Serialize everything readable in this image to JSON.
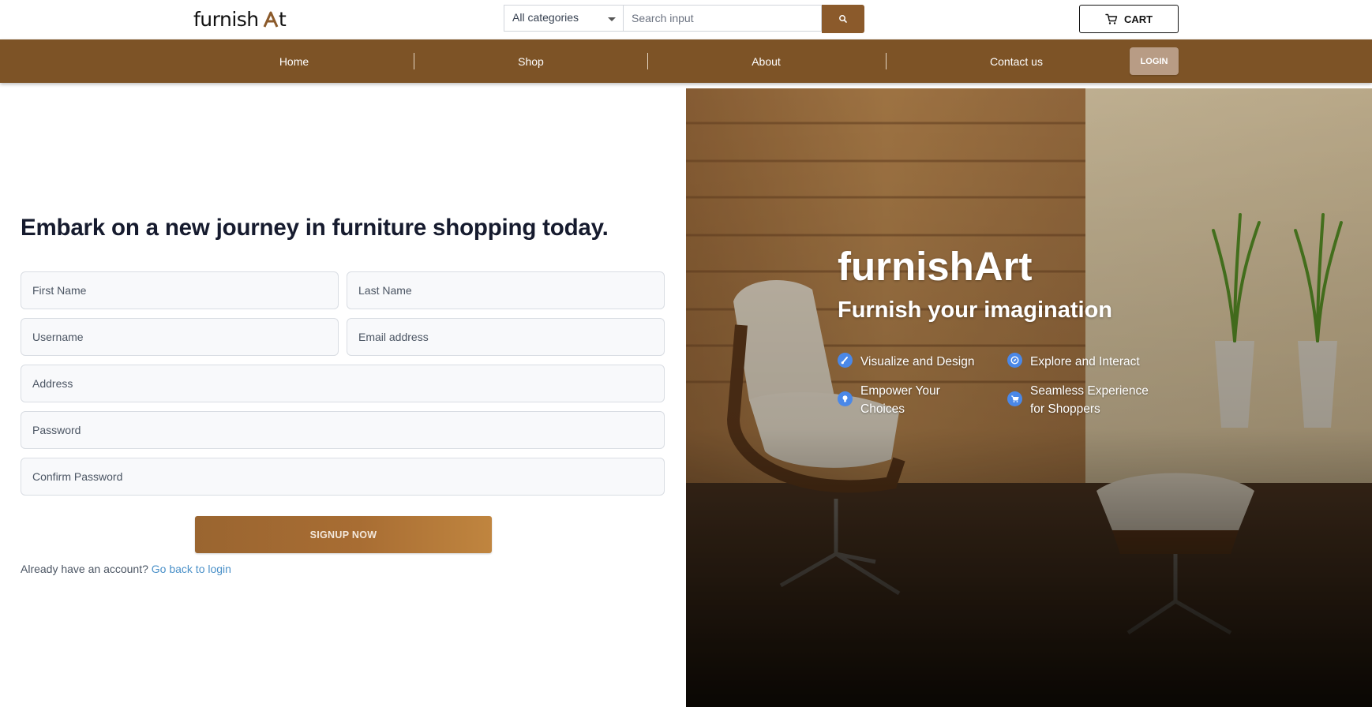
{
  "header": {
    "logo_text": "furnishArt",
    "category_select": "All categories",
    "search_placeholder": "Search input",
    "cart_label": "CART"
  },
  "nav": {
    "items": [
      {
        "label": "Home"
      },
      {
        "label": "Shop"
      },
      {
        "label": "About"
      },
      {
        "label": "Contact us"
      }
    ],
    "login_label": "LOGIN"
  },
  "form": {
    "heading": "Embark on a new journey in furniture shopping today.",
    "first_name_placeholder": "First Name",
    "last_name_placeholder": "Last Name",
    "username_placeholder": "Username",
    "email_placeholder": "Email address",
    "address_placeholder": "Address",
    "password_placeholder": "Password",
    "confirm_password_placeholder": "Confirm Password",
    "signup_label": "SIGNUP NOW",
    "already_text": "Already have an account?",
    "login_link": "Go back to login"
  },
  "hero": {
    "title": "furnishArt",
    "subtitle": "Furnish your imagination",
    "features": [
      {
        "icon": "brush-icon",
        "line1": "Visualize and Design",
        "line2": ""
      },
      {
        "icon": "compass-icon",
        "line1": "Explore and Interact",
        "line2": ""
      },
      {
        "icon": "lightbulb-icon",
        "line1": "Empower Your",
        "line2": "Choices"
      },
      {
        "icon": "cart-icon",
        "line1": "Seamless Experience",
        "line2": "for Shoppers"
      }
    ]
  },
  "colors": {
    "brand_brown": "#7d5326",
    "accent_blue": "#4a88e8",
    "link_blue": "#4a90c8"
  }
}
